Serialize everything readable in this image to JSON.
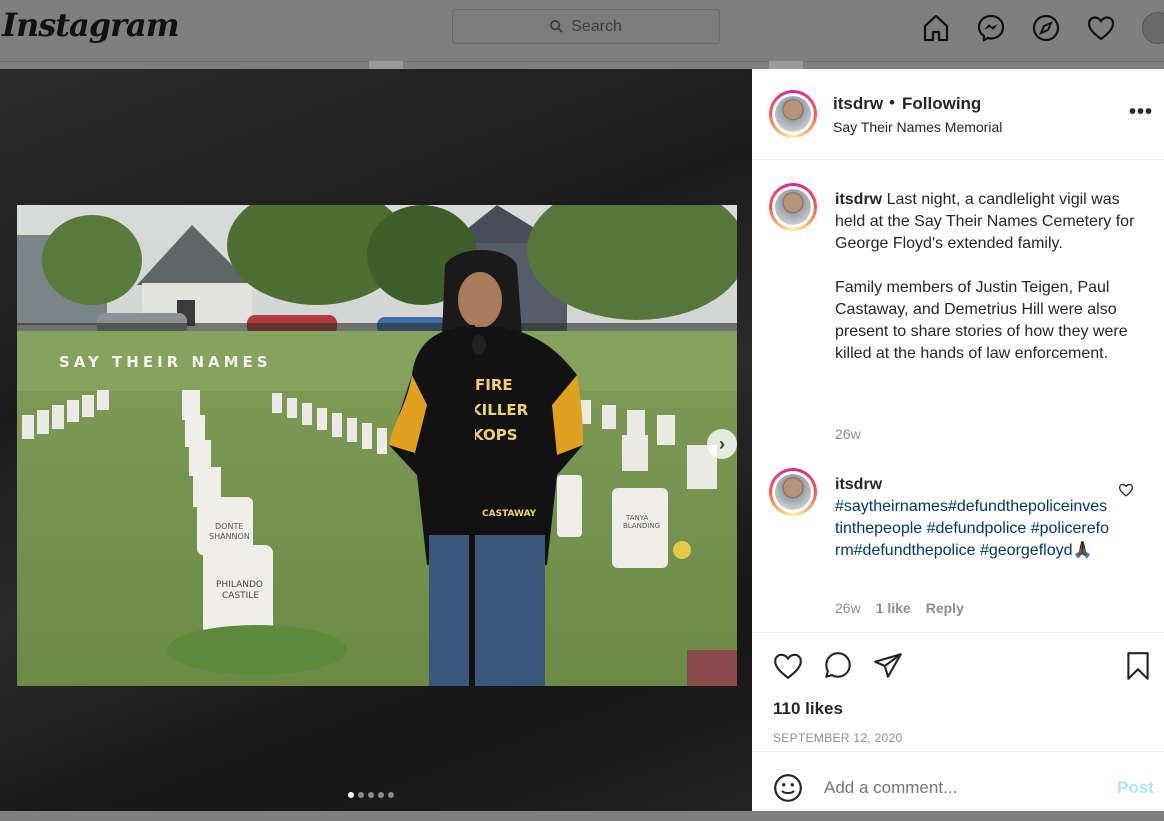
{
  "app": {
    "logo": "Instagram"
  },
  "search": {
    "placeholder": "Search"
  },
  "nav": {
    "icons": [
      "home-icon",
      "messenger-icon",
      "explore-compass-icon",
      "activity-heart-icon",
      "profile-avatar"
    ]
  },
  "post": {
    "username": "itsdrw",
    "follow_status": "Following",
    "location": "Say Their Names Memorial",
    "caption": "Last night, a candlelight vigil was held at the Say Their Names Cemetery for George Floyd's extended family.\n\nFamily members of Justin Teigen, Paul Castaway, and Demetrius Hill were also present to share stories of how they were killed at the hands of law enforcement.",
    "caption_time": "26w",
    "comment": {
      "username": "itsdrw",
      "text": "#saytheirnames#defundthepoliceinvestinthepeople #defundpolice #policereform#defundthepolice #georgefloyd🙏🏿",
      "time": "26w",
      "likes": "1 like",
      "reply": "Reply"
    },
    "likes": "110 likes",
    "date": "SEPTEMBER 12, 2020",
    "comment_placeholder": "Add a comment...",
    "post_button": "Post",
    "carousel": {
      "total": 5,
      "active": 1
    }
  },
  "photo": {
    "sign_text": "SAY THEIR NAMES",
    "headstones": [
      "DONTE SHANNON",
      "PHILANDO CASTILE",
      "TANYA BLANDING"
    ],
    "shirt_text": [
      "FIRE",
      "KILLER",
      "KOPS",
      "CASTAWAY"
    ]
  }
}
